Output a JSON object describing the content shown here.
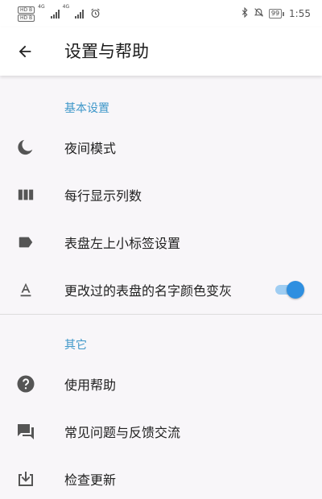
{
  "status_bar": {
    "hd_badges": [
      "HD B",
      "HD B"
    ],
    "network_labels": [
      "4G",
      "4G"
    ],
    "battery": "99",
    "time": "1:55",
    "icons": [
      "bluetooth-icon",
      "mute-icon",
      "alarm-icon"
    ]
  },
  "app_bar": {
    "back_icon": "arrow-left-icon",
    "title": "设置与帮助"
  },
  "sections": {
    "basic": {
      "header": "基本设置",
      "items": [
        {
          "label": "夜间模式",
          "icon": "moon-icon"
        },
        {
          "label": "每行显示列数",
          "icon": "columns-icon"
        },
        {
          "label": "表盘左上小标签设置",
          "icon": "label-tag-icon"
        },
        {
          "label": "更改过的表盘的名字颜色变灰",
          "icon": "text-format-icon",
          "toggle_on": true
        }
      ]
    },
    "other": {
      "header": "其它",
      "items": [
        {
          "label": "使用帮助",
          "icon": "help-circle-icon"
        },
        {
          "label": "常见问题与反馈交流",
          "icon": "feedback-chat-icon"
        },
        {
          "label": "检查更新",
          "icon": "download-box-icon"
        }
      ]
    }
  },
  "colors": {
    "accent": "#3e97c9",
    "toggle_thumb": "#2f8fe0",
    "toggle_track": "#9fcdf2",
    "icon": "#555555",
    "background": "#f8f6f9"
  }
}
